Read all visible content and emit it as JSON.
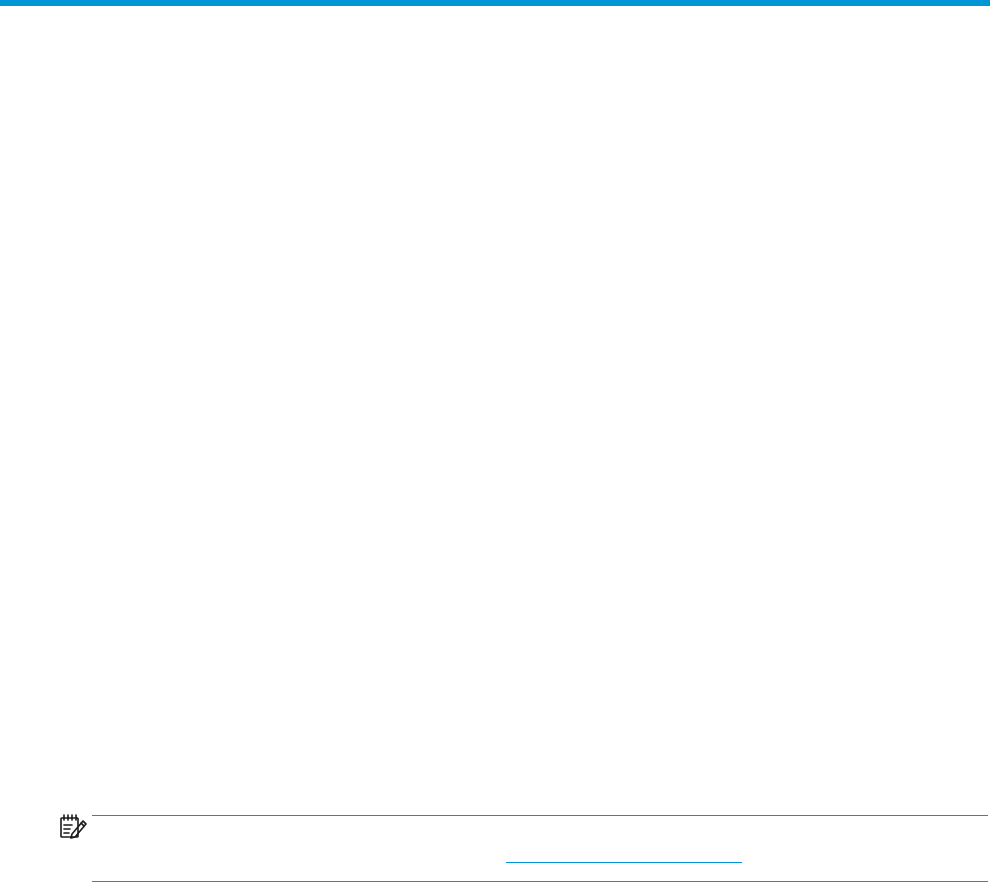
{
  "colors": {
    "accent": "#0096D6",
    "icon": "#1a1a1a",
    "background": "#ffffff"
  },
  "note": {
    "icon": "note-icon"
  }
}
